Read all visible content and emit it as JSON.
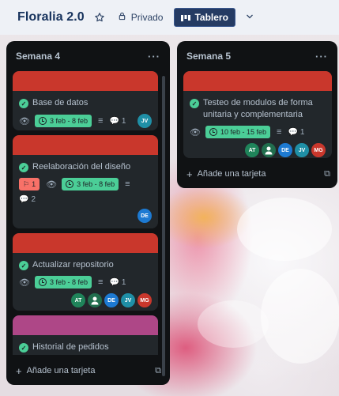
{
  "header": {
    "board_title": "Floralia 2.0",
    "star_icon": "star-icon",
    "visibility_label": "Privado",
    "view_button_label": "Tablero",
    "chevron_icon": "chevron-down-icon",
    "colors": {
      "header_bg": "#eef1f6",
      "title": "#16325c",
      "view_button_bg": "#253b63"
    }
  },
  "lists": [
    {
      "title": "Semana 4",
      "menu": "···",
      "add_card_label": "Añade una tarjeta",
      "cards": [
        {
          "cover_color": "#c9372c",
          "title": "Base de datos",
          "date": "3 feb - 8 feb",
          "comments": "1",
          "members": [
            {
              "initials": "JV",
              "color": "#1f8fa6"
            }
          ]
        },
        {
          "cover_color": "#c9372c",
          "title": "Reelaboración del diseño",
          "flag_count": "1",
          "date": "3 feb - 8 feb",
          "comments": "2",
          "members": [
            {
              "initials": "DE",
              "color": "#1d7ad2"
            }
          ]
        },
        {
          "cover_color": "#c9372c",
          "title": "Actualizar repositorio",
          "date": "3 feb - 8 feb",
          "comments": "1",
          "members": [
            {
              "initials": "AT",
              "color": "#1f845a"
            },
            {
              "initials": "",
              "color": "#216e4e"
            },
            {
              "initials": "DE",
              "color": "#1d7ad2"
            },
            {
              "initials": "JV",
              "color": "#1f8fa6"
            },
            {
              "initials": "MG",
              "color": "#c9372c"
            }
          ]
        },
        {
          "cover_color": "#ae4787",
          "title": "Historial de pedidos"
        }
      ]
    },
    {
      "title": "Semana 5",
      "menu": "···",
      "add_card_label": "Añade una tarjeta",
      "cards": [
        {
          "cover_color": "#c9372c",
          "title": "Testeo de modulos de forma unitaria y complementaria",
          "date": "10 feb - 15 feb",
          "comments": "1",
          "members": [
            {
              "initials": "AT",
              "color": "#1f845a"
            },
            {
              "initials": "",
              "color": "#216e4e"
            },
            {
              "initials": "DE",
              "color": "#1d7ad2"
            },
            {
              "initials": "JV",
              "color": "#1f8fa6"
            },
            {
              "initials": "MG",
              "color": "#c9372c"
            }
          ]
        }
      ]
    }
  ]
}
